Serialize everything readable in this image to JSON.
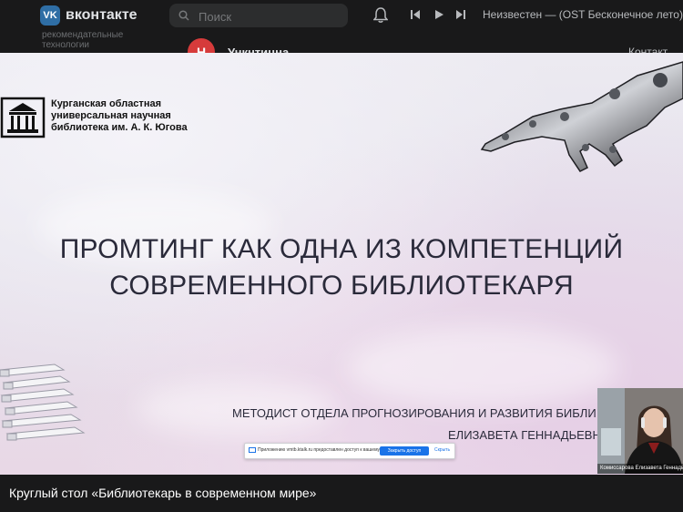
{
  "header": {
    "logo_text": "VK",
    "brand": "вконтакте",
    "search_placeholder": "Поиск",
    "track": "Неизвестен — (OST Бесконечное лето)",
    "subtext": "рекомендательные технологии",
    "group_avatar_text": "Н",
    "group_name": "Ункнтицна",
    "contacts": "Контакт"
  },
  "slide": {
    "org_name_line1": "Курганская областная",
    "org_name_line2": "универсальная научная",
    "org_name_line3": "библиотека им. А. К. Югова",
    "title_line1": "ПРОМТИНГ КАК ОДНА ИЗ КОМПЕТЕНЦИЙ",
    "title_line2": "СОВРЕМЕННОГО БИБЛИОТЕКАРЯ",
    "role": "МЕТОДИСТ ОТДЕЛА ПРОГНОЗИРОВАНИЯ И РАЗВИТИЯ БИБЛИ",
    "speaker": "ЕЛИЗАВЕТА ГЕННАДЬЕВН"
  },
  "screen_share_notice": {
    "text": "Приложению vmtb.ktalk.ru предоставлен доступ к вашему экрану.",
    "stop_button": "Закрыть доступ",
    "hide_button": "Скрыть"
  },
  "camera": {
    "participant": "Комиссарова Елизавета Геннадьевна"
  },
  "caption": "Круглый стол «Библиотекарь в современном мире»",
  "colors": {
    "vk_header": "#19191a",
    "vk_accent": "#2f6ea5",
    "share_button": "#1a73e8"
  }
}
